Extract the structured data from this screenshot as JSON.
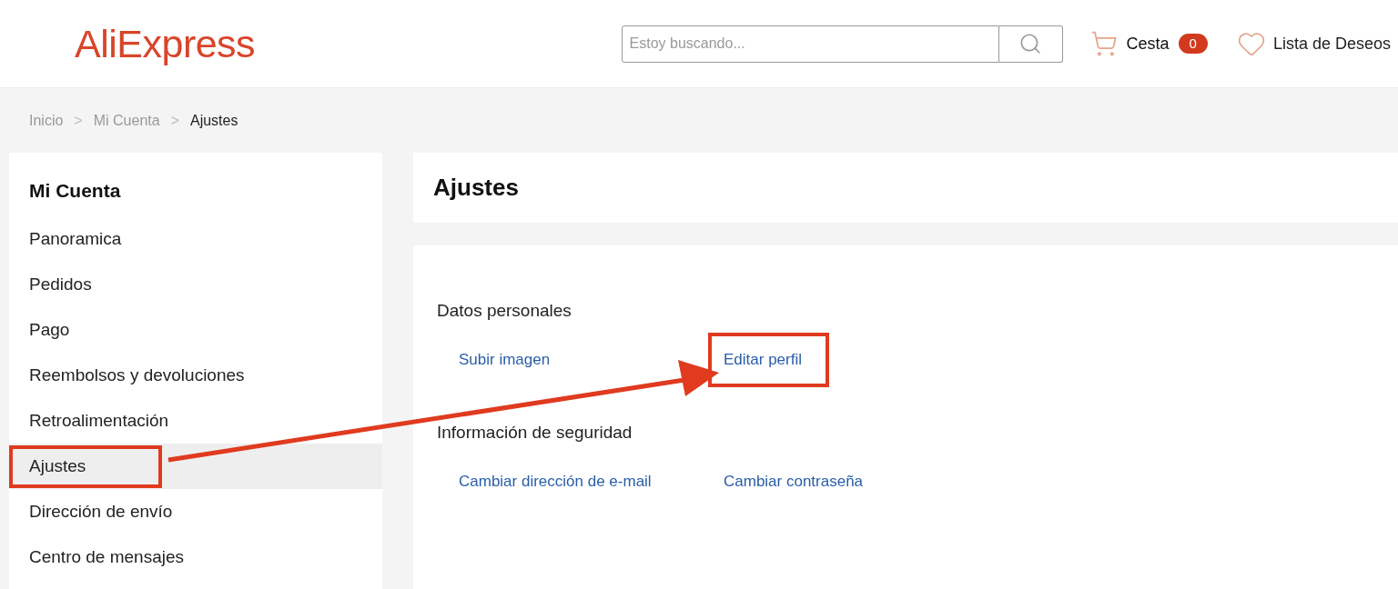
{
  "header": {
    "logo": "AliExpress",
    "search": {
      "placeholder": "Estoy buscando..."
    },
    "cart": {
      "label": "Cesta",
      "count": "0"
    },
    "wishlist": {
      "label": "Lista de Deseos"
    }
  },
  "breadcrumb": [
    {
      "label": "Inicio",
      "current": false
    },
    {
      "label": "Mi Cuenta",
      "current": false
    },
    {
      "label": "Ajustes",
      "current": true
    }
  ],
  "breadcrumb_separator": ">",
  "sidebar": {
    "title": "Mi Cuenta",
    "items": [
      {
        "label": "Panoramica",
        "selected": false,
        "annotated": false
      },
      {
        "label": "Pedidos",
        "selected": false,
        "annotated": false
      },
      {
        "label": "Pago",
        "selected": false,
        "annotated": false
      },
      {
        "label": "Reembolsos y devoluciones",
        "selected": false,
        "annotated": false
      },
      {
        "label": "Retroalimentación",
        "selected": false,
        "annotated": false
      },
      {
        "label": "Ajustes",
        "selected": true,
        "annotated": true
      },
      {
        "label": "Dirección de envío",
        "selected": false,
        "annotated": false
      },
      {
        "label": "Centro de mensajes",
        "selected": false,
        "annotated": false
      }
    ]
  },
  "main": {
    "title": "Ajustes",
    "sections": [
      {
        "heading": "Datos personales",
        "links": [
          {
            "label": "Subir imagen",
            "annotated": false
          },
          {
            "label": "Editar perfil",
            "annotated": true
          }
        ]
      },
      {
        "heading": "Información de seguridad",
        "links": [
          {
            "label": "Cambiar dirección de e-mail",
            "annotated": false
          },
          {
            "label": "Cambiar contraseña",
            "annotated": false
          }
        ]
      }
    ]
  },
  "annotation": {
    "arrow": true
  }
}
